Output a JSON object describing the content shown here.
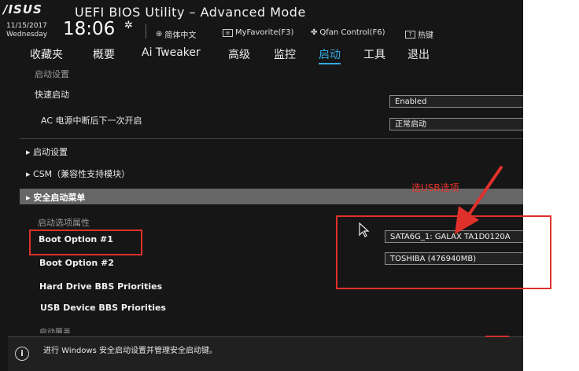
{
  "header": {
    "logo": "/ISUS",
    "title": "UEFI BIOS Utility – Advanced Mode",
    "date": "11/15/2017",
    "weekday": "Wednesday",
    "time": "18:06",
    "toolbar": {
      "language": "简体中文",
      "favorite": "MyFavorite(F3)",
      "qfan": "Qfan Control(F6)",
      "hotkeys": "热键"
    }
  },
  "tabs": [
    "收藏夹",
    "概要",
    "Ai Tweaker",
    "高级",
    "监控",
    "启动",
    "工具",
    "退出"
  ],
  "active_tab": "启动",
  "content": {
    "section_header": "启动设置",
    "fast_boot_label": "快速启动",
    "fast_boot_value": "Enabled",
    "ac_power_label": "AC 电源中断后下一次开启",
    "ac_power_value": "正常启动",
    "submenu_boot": "▸ 启动设置",
    "submenu_csm": "▸ CSM（兼容性支持模块）",
    "submenu_secure": "▸ 安全启动菜单",
    "boot_priority_header": "启动选项属性",
    "boot_option_1_label": "Boot Option #1",
    "boot_option_1_value": "SATA6G_1: GALAX TA1D0120A",
    "boot_option_2_label": "Boot Option #2",
    "boot_option_2_value": "TOSHIBA  (476940MB)",
    "hdd_bbs": "Hard Drive BBS Priorities",
    "usb_bbs": "USB Device BBS Priorities",
    "cut_off": "启动覆盖"
  },
  "footer": {
    "help_text": "进行 Windows 安全启动设置并管理安全启动键。",
    "help_glyph": "i"
  },
  "annotation": {
    "text": "选USB选项",
    "color": "#e8352d"
  }
}
